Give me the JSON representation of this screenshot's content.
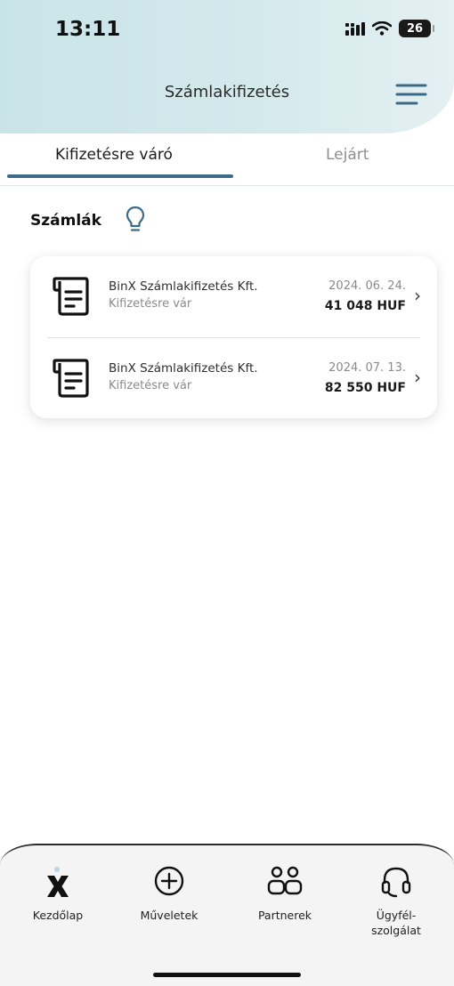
{
  "status_bar": {
    "time": "13:11",
    "battery": "26"
  },
  "header": {
    "title": "Számlakifizetés"
  },
  "tabs": [
    {
      "label": "Kifizetésre váró",
      "active": true
    },
    {
      "label": "Lejárt",
      "active": false
    }
  ],
  "section": {
    "title": "Számlák"
  },
  "invoices": [
    {
      "company": "BinX Számlakifizetés Kft.",
      "status": "Kifizetésre vár",
      "date": "2024. 06. 24.",
      "amount": "41 048 HUF"
    },
    {
      "company": "BinX Számlakifizetés Kft.",
      "status": "Kifizetésre vár",
      "date": "2024. 07. 13.",
      "amount": "82 550 HUF"
    }
  ],
  "bottom_nav": [
    {
      "label": "Kezdőlap",
      "icon": "home-x-logo-icon"
    },
    {
      "label": "Műveletek",
      "icon": "plus-circle-icon"
    },
    {
      "label": "Partnerek",
      "icon": "partners-icon"
    },
    {
      "label": "Ügyfél-\nszolgálat",
      "icon": "headset-icon"
    }
  ],
  "colors": {
    "accent": "#3d6c8a",
    "header_bg": "#cfe6ea",
    "text": "#1b1b1b",
    "muted": "#8a8a8a"
  }
}
